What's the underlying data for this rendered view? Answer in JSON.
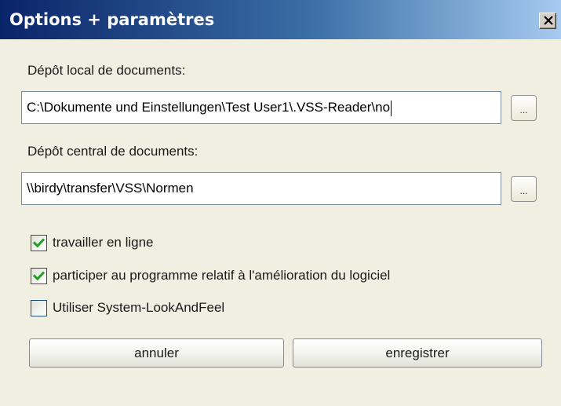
{
  "window": {
    "title": "Options + paramètres",
    "close_label": "Close"
  },
  "local_repo": {
    "label": "Dépôt local de documents:",
    "value": "C:\\Dokumente und Einstellungen\\Test User1\\.VSS-Reader\\no",
    "browse_label": "..."
  },
  "central_repo": {
    "label": "Dépôt central de documents:",
    "value": "\\\\birdy\\transfer\\VSS\\Normen",
    "browse_label": "..."
  },
  "options": [
    {
      "label": "travailler en ligne",
      "checked": true
    },
    {
      "label": "participer au programme relatif à l'amélioration du logiciel",
      "checked": true
    },
    {
      "label": "Utiliser System-LookAndFeel",
      "checked": false
    }
  ],
  "buttons": {
    "cancel_label": "annuler",
    "save_label": "enregistrer"
  },
  "colors": {
    "check": "#21a121",
    "title_bar_start": "#0a246a",
    "title_bar_end": "#a6caf0"
  }
}
